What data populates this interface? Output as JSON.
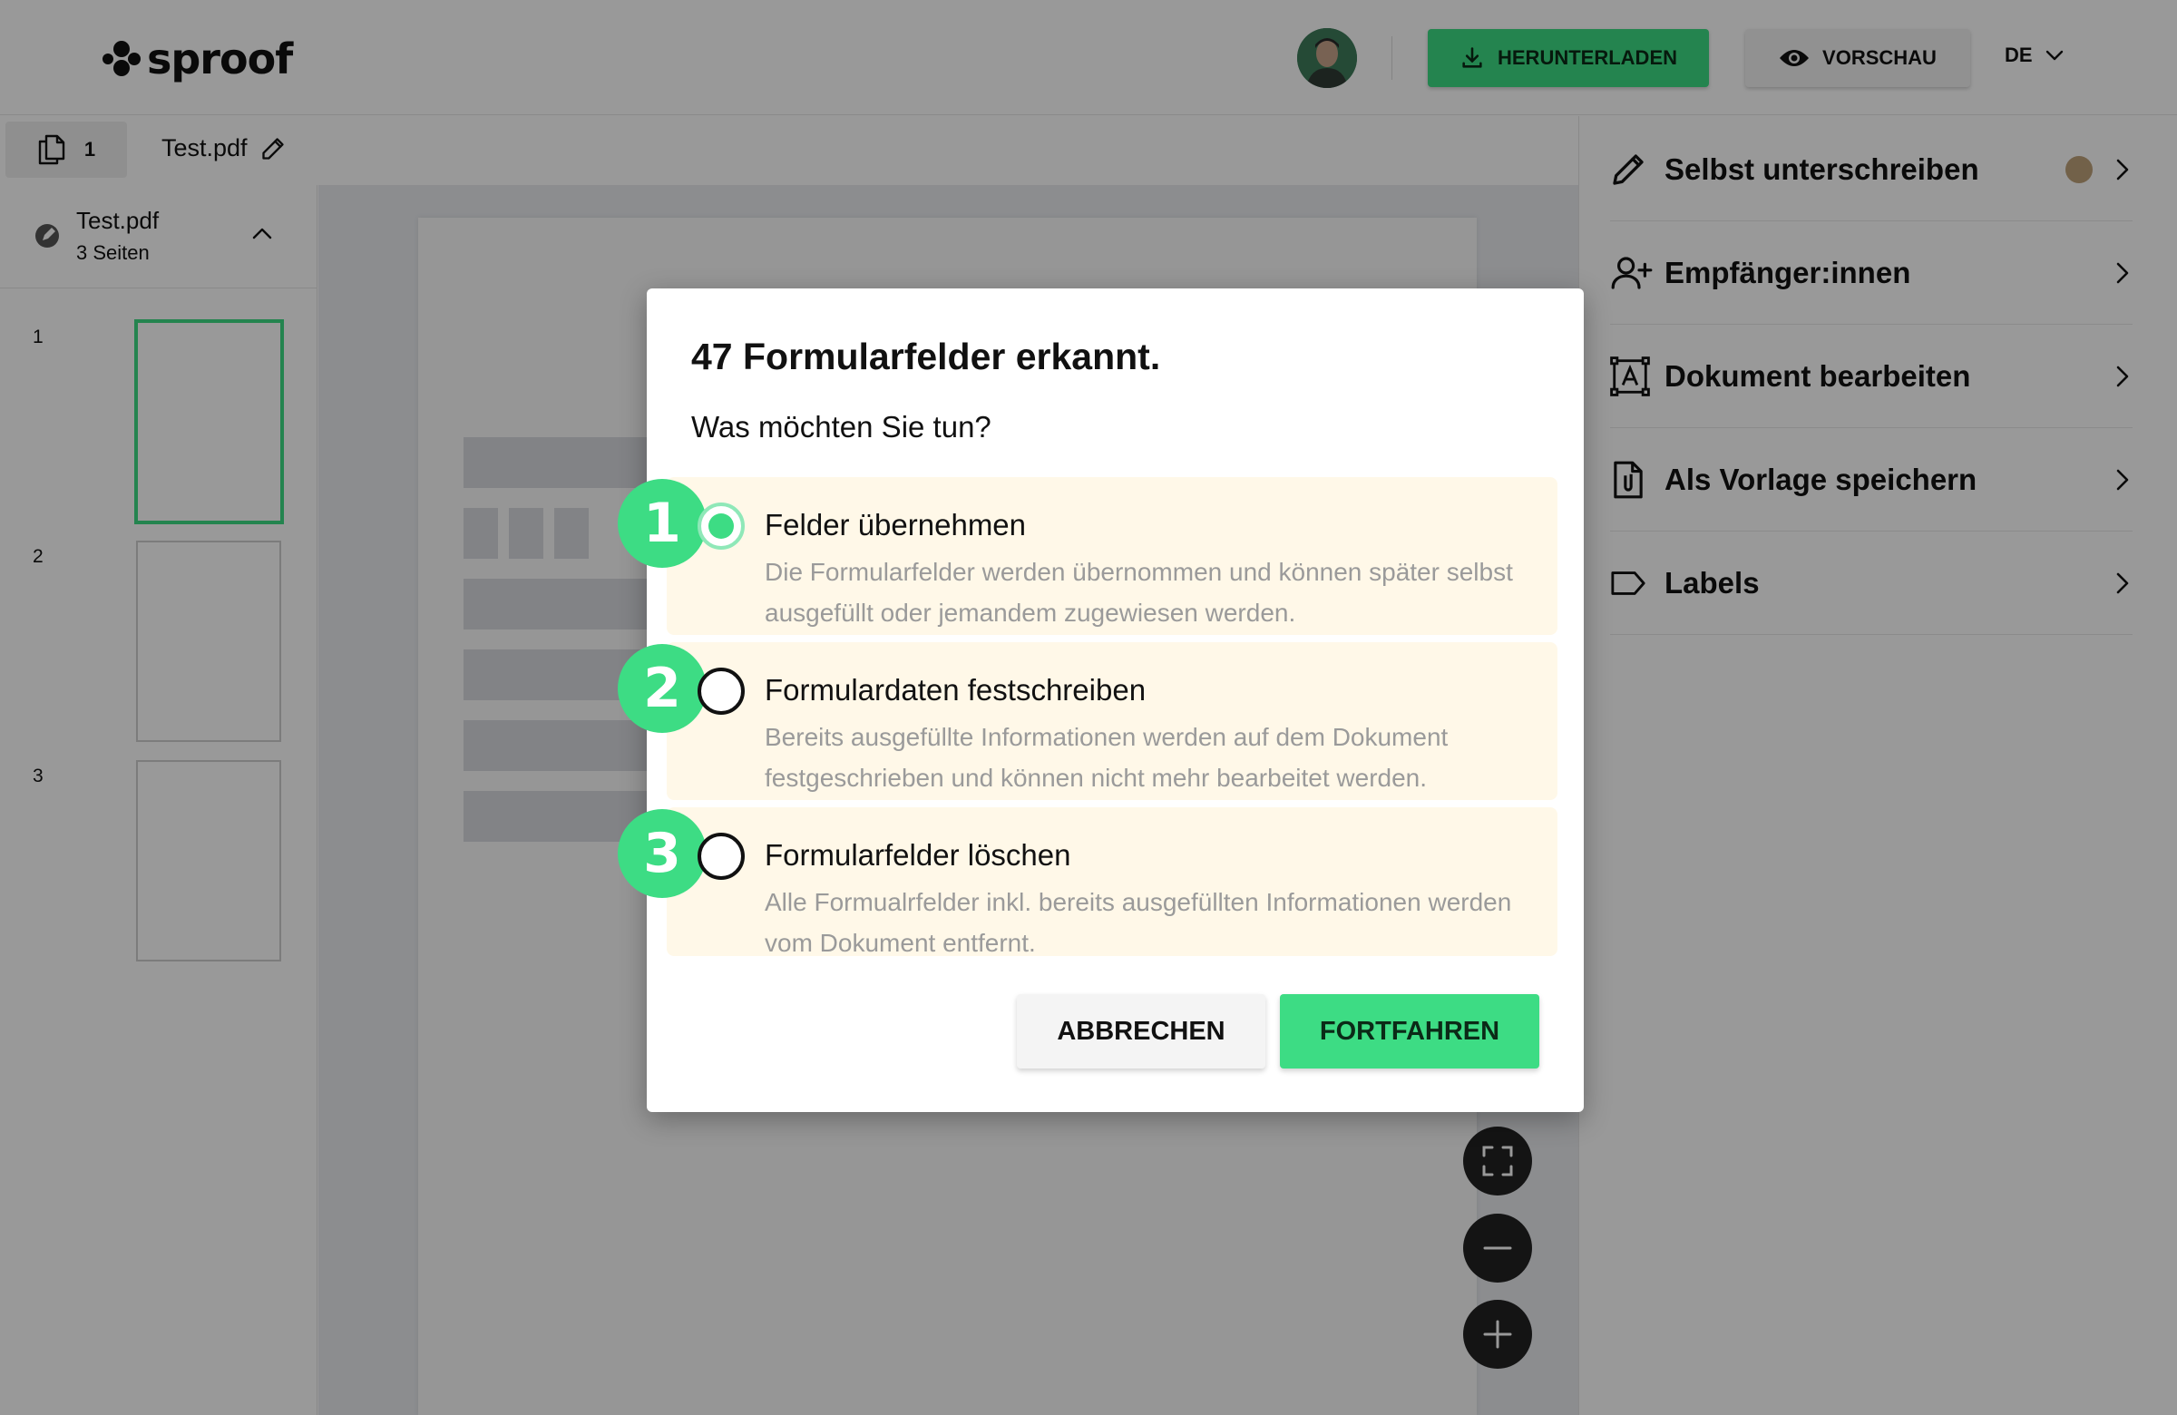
{
  "header": {
    "logo_text": "sproof",
    "download_label": "HERUNTERLADEN",
    "preview_label": "VORSCHAU",
    "language": "DE"
  },
  "toolbar": {
    "pages_count": "1",
    "filename": "Test.pdf"
  },
  "sidebar": {
    "document_name": "Test.pdf",
    "document_pages": "3 Seiten",
    "pages": [
      {
        "number": "1"
      },
      {
        "number": "2"
      },
      {
        "number": "3"
      }
    ]
  },
  "right_panel": {
    "items": [
      {
        "label": "Selbst unterschreiben",
        "icon": "pen-icon"
      },
      {
        "label": "Empfänger:innen",
        "icon": "add-user-icon"
      },
      {
        "label": "Dokument bearbeiten",
        "icon": "text-frame-icon"
      },
      {
        "label": "Als Vorlage speichern",
        "icon": "template-file-icon"
      },
      {
        "label": "Labels",
        "icon": "label-tag-icon"
      }
    ]
  },
  "modal": {
    "title": "47 Formularfelder erkannt.",
    "subtitle": "Was möchten Sie tun?",
    "options": [
      {
        "step": "1",
        "title": "Felder übernehmen",
        "description": "Die Formularfelder werden übernommen und können später selbst ausgefüllt oder jemandem zugewiesen werden.",
        "selected": true
      },
      {
        "step": "2",
        "title": "Formulardaten festschreiben",
        "description": "Bereits ausgefüllte Informationen werden auf dem Dokument festgeschrieben und können nicht mehr bearbeitet werden.",
        "selected": false
      },
      {
        "step": "3",
        "title": "Formularfelder löschen",
        "description": "Alle Formualrfelder inkl. bereits ausgefüllten Informationen werden vom Dokument entfernt.",
        "selected": false
      }
    ],
    "cancel_label": "ABBRECHEN",
    "continue_label": "FORTFAHREN"
  },
  "colors": {
    "accent": "#3ddc84",
    "option_background": "#fff8e8",
    "overlay": "rgba(0,0,0,0.40)"
  }
}
